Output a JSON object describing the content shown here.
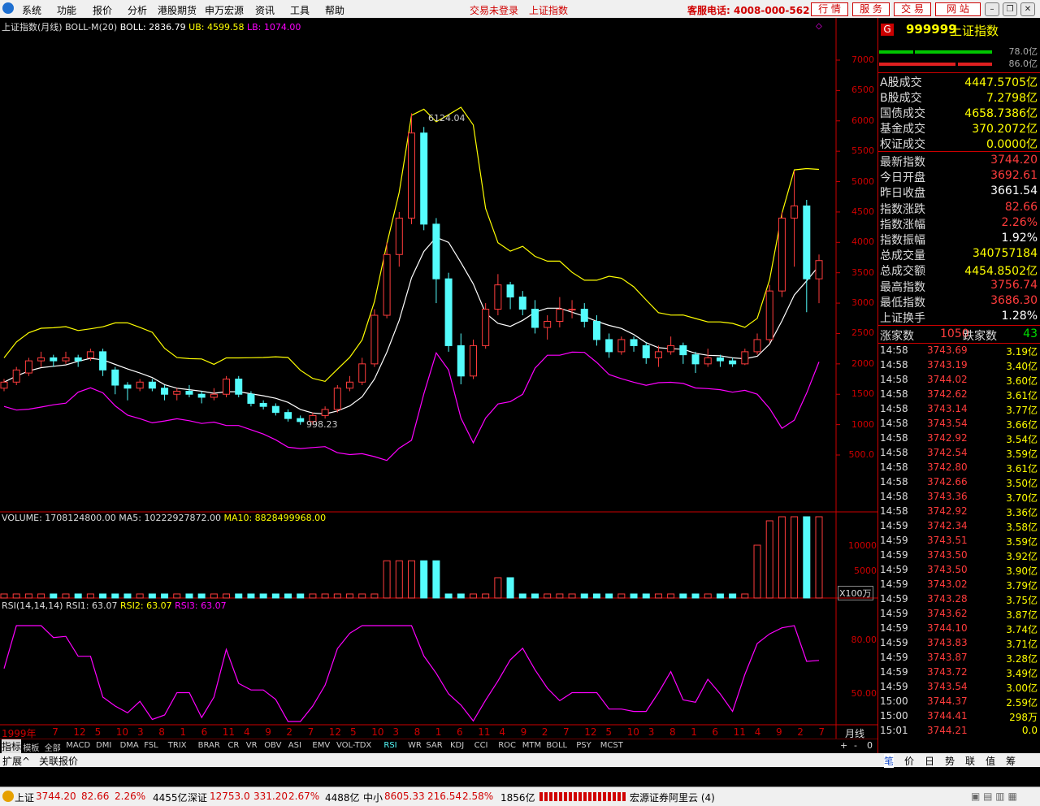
{
  "menu": {
    "items": [
      "系统",
      "功能",
      "报价",
      "分析",
      "港股期货",
      "申万宏源",
      "资讯",
      "工具",
      "帮助"
    ],
    "login_status": "交易未登录",
    "index_name": "上证指数",
    "hotline": "客服电话: 4008-000-562",
    "buttons": [
      "行 情",
      "服 务",
      "交 易",
      "网 站"
    ]
  },
  "main_chart": {
    "header_title": "上证指数(月线) BOLL-M(20)",
    "boll": "BOLL: 2836.79",
    "ub": "UB: 4599.58",
    "lb": "LB: 1074.00",
    "y_ticks": [
      "7000",
      "6500",
      "6000",
      "5500",
      "5000",
      "4500",
      "4000",
      "3500",
      "3000",
      "2500",
      "2000",
      "1500",
      "1000",
      "500.0"
    ],
    "high_label": "6124.04",
    "low_label": "998.23"
  },
  "volume_chart": {
    "header": "VOLUME: 1708124800.00",
    "ma5": "MA5: 10222927872.00",
    "ma10": "MA10: 8828499968.00",
    "y_ticks": [
      "10000",
      "5000"
    ],
    "unit": "X100万"
  },
  "rsi_chart": {
    "header": "RSI(14,14,14)",
    "rsi1": "RSI1: 63.07",
    "rsi2": "RSI2: 63.07",
    "rsi3": "RSI3: 63.07",
    "y_ticks": [
      "80.00",
      "50.00"
    ]
  },
  "x_axis": {
    "labels": [
      "1999年",
      "7",
      "12",
      "5",
      "10",
      "3",
      "8",
      "1",
      "6",
      "11",
      "4",
      "9",
      "2",
      "7",
      "12",
      "5",
      "10",
      "3",
      "8",
      "1",
      "6",
      "11",
      "4",
      "9",
      "2",
      "7",
      "12",
      "5",
      "10",
      "3",
      "8",
      "1",
      "6",
      "11",
      "4",
      "9",
      "2",
      "7"
    ],
    "period": "月线",
    "controls": [
      "+",
      "-",
      "0"
    ]
  },
  "indicator_tabs": [
    "指标",
    "模板",
    "全部",
    "MACD",
    "DMI",
    "DMA",
    "FSL",
    "TRIX",
    "BRAR",
    "CR",
    "VR",
    "OBV",
    "ASI",
    "EMV",
    "VOL-TDX",
    "RSI",
    "WR",
    "SAR",
    "KDJ",
    "CCI",
    "ROC",
    "MTM",
    "BOLL",
    "PSY",
    "MCST"
  ],
  "bottom_tabs": [
    "扩展^",
    "关联报价"
  ],
  "right_panel": {
    "code_badge": "G",
    "code": "999999",
    "name": "上证指数",
    "bar_green_val": "78.0亿",
    "bar_red_val": "86.0亿",
    "turnover": [
      {
        "k": "A股成交",
        "v": "4447.5705亿"
      },
      {
        "k": "B股成交",
        "v": "7.2798亿"
      },
      {
        "k": "国债成交",
        "v": "4658.7386亿"
      },
      {
        "k": "基金成交",
        "v": "370.2072亿"
      },
      {
        "k": "权证成交",
        "v": "0.0000亿"
      }
    ],
    "quote": [
      {
        "k": "最新指数",
        "v": "3744.20",
        "c": "#ff3c3c"
      },
      {
        "k": "今日开盘",
        "v": "3692.61",
        "c": "#ff3c3c"
      },
      {
        "k": "昨日收盘",
        "v": "3661.54",
        "c": "#ffffff"
      },
      {
        "k": "指数涨跌",
        "v": "82.66",
        "c": "#ff3c3c"
      },
      {
        "k": "指数涨幅",
        "v": "2.26%",
        "c": "#ff3c3c"
      },
      {
        "k": "指数振幅",
        "v": "1.92%",
        "c": "#ffffff"
      },
      {
        "k": "总成交量",
        "v": "340757184",
        "c": "#ffff00"
      },
      {
        "k": "总成交额",
        "v": "4454.8502亿",
        "c": "#ffff00"
      },
      {
        "k": "最高指数",
        "v": "3756.74",
        "c": "#ff3c3c"
      },
      {
        "k": "最低指数",
        "v": "3686.30",
        "c": "#ff3c3c"
      },
      {
        "k": "上证换手",
        "v": "1.28%",
        "c": "#ffffff"
      }
    ],
    "adv_label": "涨家数",
    "adv": "1050",
    "dec_label": "跌家数",
    "dec": "43",
    "ticks": [
      {
        "t": "14:58",
        "p": "3743.69",
        "q": "3.19亿"
      },
      {
        "t": "14:58",
        "p": "3743.19",
        "q": "3.40亿"
      },
      {
        "t": "14:58",
        "p": "3744.02",
        "q": "3.60亿"
      },
      {
        "t": "14:58",
        "p": "3742.62",
        "q": "3.61亿"
      },
      {
        "t": "14:58",
        "p": "3743.14",
        "q": "3.77亿"
      },
      {
        "t": "14:58",
        "p": "3743.54",
        "q": "3.66亿"
      },
      {
        "t": "14:58",
        "p": "3742.92",
        "q": "3.54亿"
      },
      {
        "t": "14:58",
        "p": "3742.54",
        "q": "3.59亿"
      },
      {
        "t": "14:58",
        "p": "3742.80",
        "q": "3.61亿"
      },
      {
        "t": "14:58",
        "p": "3742.66",
        "q": "3.50亿"
      },
      {
        "t": "14:58",
        "p": "3743.36",
        "q": "3.70亿"
      },
      {
        "t": "14:58",
        "p": "3742.92",
        "q": "3.36亿"
      },
      {
        "t": "14:59",
        "p": "3742.34",
        "q": "3.58亿"
      },
      {
        "t": "14:59",
        "p": "3743.51",
        "q": "3.59亿"
      },
      {
        "t": "14:59",
        "p": "3743.50",
        "q": "3.92亿"
      },
      {
        "t": "14:59",
        "p": "3743.50",
        "q": "3.90亿"
      },
      {
        "t": "14:59",
        "p": "3743.02",
        "q": "3.79亿"
      },
      {
        "t": "14:59",
        "p": "3743.28",
        "q": "3.75亿"
      },
      {
        "t": "14:59",
        "p": "3743.62",
        "q": "3.87亿"
      },
      {
        "t": "14:59",
        "p": "3744.10",
        "q": "3.74亿"
      },
      {
        "t": "14:59",
        "p": "3743.83",
        "q": "3.71亿"
      },
      {
        "t": "14:59",
        "p": "3743.87",
        "q": "3.28亿"
      },
      {
        "t": "14:59",
        "p": "3743.72",
        "q": "3.49亿"
      },
      {
        "t": "14:59",
        "p": "3743.54",
        "q": "3.00亿"
      },
      {
        "t": "15:00",
        "p": "3744.37",
        "q": "2.59亿"
      },
      {
        "t": "15:00",
        "p": "3744.41",
        "q": "298万"
      },
      {
        "t": "15:01",
        "p": "3744.21",
        "q": "0.0"
      }
    ],
    "tabs": [
      "笔",
      "价",
      "日",
      "势",
      "联",
      "值",
      "筹"
    ]
  },
  "status_bar": {
    "sh_label": "上证",
    "sh_val": "3744.20",
    "sh_chg": "82.66",
    "sh_pct": "2.26%",
    "sh_amt": "4455亿",
    "sz_label": "深证",
    "sz_val": "12753.0",
    "sz_chg": "331.20",
    "sz_pct": "2.67%",
    "sz_amt": "4488亿",
    "zx_label": "中小",
    "zx_val": "8605.33",
    "zx_chg": "216.54",
    "zx_pct": "2.58%",
    "zx_amt": "1856亿",
    "broker": "宏源证券阿里云 (4)"
  },
  "colors": {
    "up": "#ff3c3c",
    "down": "#54fcfc",
    "boll_mid": "#ffffff",
    "boll_ub": "#ffff00",
    "boll_lb": "#ff00ff",
    "rsi": "#ff00ff",
    "grid": "#800000"
  },
  "chart_data": {
    "type": "candlestick",
    "title": "上证指数(月线)",
    "indicators": [
      "BOLL-M(20)",
      "VOLUME",
      "RSI(14,14,14)"
    ],
    "ylim": [
      0,
      7400
    ],
    "candles_approx": [
      [
        1999.5,
        1600,
        1700,
        1550,
        1750
      ],
      [
        1999.75,
        1700,
        1900,
        1650,
        1950
      ],
      [
        2000.0,
        1850,
        2050,
        1800,
        2100
      ],
      [
        2000.25,
        2050,
        2100,
        1950,
        2200
      ],
      [
        2000.5,
        2100,
        2050,
        1950,
        2150
      ],
      [
        2000.75,
        2050,
        2100,
        2000,
        2200
      ],
      [
        2001.0,
        2100,
        2050,
        1950,
        2150
      ],
      [
        2001.25,
        2100,
        2200,
        2050,
        2250
      ],
      [
        2001.5,
        2200,
        1900,
        1800,
        2250
      ],
      [
        2001.75,
        1900,
        1650,
        1500,
        1950
      ],
      [
        2002.0,
        1650,
        1600,
        1400,
        1700
      ],
      [
        2002.25,
        1600,
        1700,
        1550,
        1750
      ],
      [
        2002.5,
        1700,
        1600,
        1550,
        1750
      ],
      [
        2002.75,
        1600,
        1500,
        1400,
        1650
      ],
      [
        2003.0,
        1500,
        1550,
        1400,
        1600
      ],
      [
        2003.25,
        1550,
        1500,
        1450,
        1650
      ],
      [
        2003.5,
        1500,
        1450,
        1350,
        1550
      ],
      [
        2003.75,
        1450,
        1500,
        1400,
        1600
      ],
      [
        2004.0,
        1500,
        1750,
        1450,
        1800
      ],
      [
        2004.25,
        1750,
        1500,
        1450,
        1800
      ],
      [
        2004.5,
        1500,
        1350,
        1300,
        1550
      ],
      [
        2004.75,
        1350,
        1300,
        1250,
        1400
      ],
      [
        2005.0,
        1300,
        1200,
        1150,
        1350
      ],
      [
        2005.25,
        1200,
        1100,
        1050,
        1250
      ],
      [
        2005.5,
        1100,
        1050,
        998,
        1150
      ],
      [
        2005.75,
        1050,
        1150,
        1000,
        1200
      ],
      [
        2006.0,
        1150,
        1250,
        1100,
        1300
      ],
      [
        2006.25,
        1250,
        1600,
        1200,
        1650
      ],
      [
        2006.5,
        1600,
        1700,
        1550,
        1800
      ],
      [
        2006.75,
        1700,
        2000,
        1650,
        2100
      ],
      [
        2007.0,
        2000,
        2800,
        1950,
        2900
      ],
      [
        2007.25,
        2800,
        3800,
        2750,
        4000
      ],
      [
        2007.5,
        3800,
        4400,
        3600,
        4500
      ],
      [
        2007.75,
        4400,
        5800,
        4300,
        6124
      ],
      [
        2008.0,
        5800,
        4300,
        4200,
        5900
      ],
      [
        2008.25,
        4300,
        3400,
        3000,
        4400
      ],
      [
        2008.5,
        3400,
        2300,
        2200,
        3500
      ],
      [
        2008.75,
        2300,
        1800,
        1664,
        2500
      ],
      [
        2009.0,
        1800,
        2300,
        1750,
        2400
      ],
      [
        2009.25,
        2300,
        2900,
        2250,
        3000
      ],
      [
        2009.5,
        2900,
        3300,
        2800,
        3478
      ],
      [
        2009.75,
        3300,
        3100,
        2900,
        3350
      ],
      [
        2010.0,
        3100,
        2900,
        2800,
        3200
      ],
      [
        2010.25,
        2900,
        2600,
        2500,
        3050
      ],
      [
        2010.5,
        2600,
        2700,
        2400,
        2800
      ],
      [
        2010.75,
        2700,
        2900,
        2600,
        3100
      ],
      [
        2011.0,
        2900,
        2900,
        2750,
        3050
      ],
      [
        2011.25,
        2900,
        2700,
        2600,
        3000
      ],
      [
        2011.5,
        2700,
        2400,
        2300,
        2800
      ],
      [
        2011.75,
        2400,
        2200,
        2100,
        2500
      ],
      [
        2012.0,
        2200,
        2400,
        2150,
        2450
      ],
      [
        2012.25,
        2400,
        2300,
        2200,
        2450
      ],
      [
        2012.5,
        2300,
        2100,
        2000,
        2350
      ],
      [
        2012.75,
        2100,
        2200,
        1950,
        2300
      ],
      [
        2013.0,
        2200,
        2300,
        2150,
        2450
      ],
      [
        2013.25,
        2300,
        2150,
        2000,
        2350
      ],
      [
        2013.5,
        2150,
        2000,
        1850,
        2200
      ],
      [
        2013.75,
        2000,
        2100,
        1950,
        2250
      ],
      [
        2014.0,
        2100,
        2050,
        1950,
        2150
      ],
      [
        2014.25,
        2050,
        2000,
        1950,
        2100
      ],
      [
        2014.5,
        2000,
        2200,
        1980,
        2250
      ],
      [
        2014.75,
        2200,
        2400,
        2150,
        2500
      ],
      [
        2015.0,
        2400,
        3200,
        2350,
        3300
      ],
      [
        2015.25,
        3200,
        4400,
        3100,
        4500
      ],
      [
        2015.5,
        4400,
        4600,
        3600,
        5178
      ],
      [
        2015.75,
        4600,
        3400,
        2850,
        4700
      ],
      [
        2016.0,
        3400,
        3700,
        3000,
        3800
      ]
    ]
  }
}
